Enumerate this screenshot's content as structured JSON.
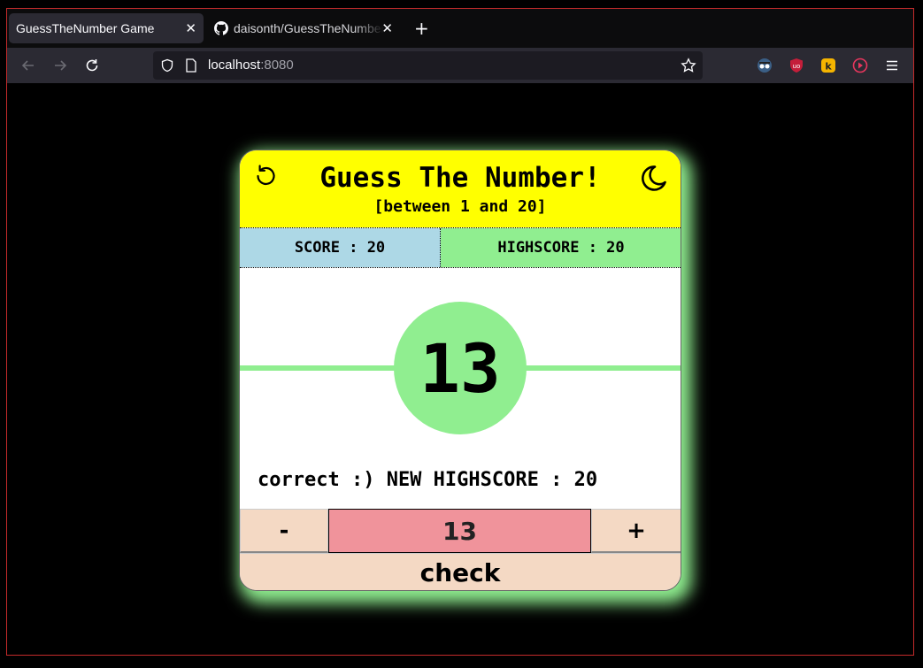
{
  "browser": {
    "tabs": [
      {
        "label": "GuessTheNumber Game",
        "active": true
      },
      {
        "label": "daisonth/GuessTheNumber",
        "active": false
      }
    ],
    "url_host": "localhost",
    "url_port": ":8080"
  },
  "icons": {
    "back": "arrow-left-icon",
    "forward": "arrow-right-icon",
    "reload": "reload-icon",
    "shield": "shield-icon",
    "page": "page-icon",
    "bookmark": "star-icon",
    "menu": "hamburger-menu-icon",
    "reset": "reset-icon",
    "theme": "moon-icon"
  },
  "game": {
    "title": "Guess The Number!",
    "subtitle": "[between 1 and 20]",
    "score_text": "SCORE : 20",
    "highscore_text": "HIGHSCORE : 20",
    "secret_number": "13",
    "message": "correct :) NEW HIGHSCORE : 20",
    "minus_label": "-",
    "plus_label": "+",
    "guess_value": "13",
    "check_label": "check"
  },
  "colors": {
    "header": "#ffff00",
    "score_bg": "#add8e6",
    "highscore_bg": "#90ee90",
    "circle": "#90ee90",
    "input_bg": "#f0939b",
    "button_bg": "#f4d9c4"
  }
}
